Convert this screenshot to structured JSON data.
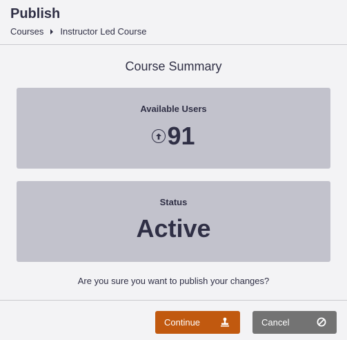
{
  "header": {
    "title": "Publish",
    "breadcrumb": [
      "Courses",
      "Instructor Led Course"
    ]
  },
  "summary": {
    "title": "Course Summary",
    "users_label": "Available Users",
    "users_value": "91",
    "status_label": "Status",
    "status_value": "Active"
  },
  "confirm_text": "Are you sure you want to publish your changes?",
  "buttons": {
    "continue_label": "Continue",
    "continue_icon": "stamp-icon",
    "cancel_label": "Cancel",
    "cancel_icon": "cancel-circle-icon"
  },
  "colors": {
    "continue_bg": "#c1590f",
    "cancel_bg": "#737373",
    "card_bg": "#c2c2cc",
    "text": "#2f2f45"
  }
}
